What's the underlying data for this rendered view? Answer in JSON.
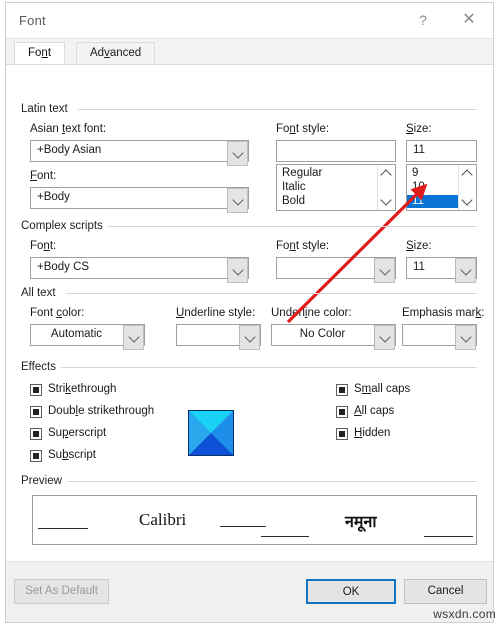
{
  "window": {
    "title": "Font",
    "help_icon": "question-mark-icon",
    "close_icon": "close-icon"
  },
  "tabs": [
    {
      "label": "Font",
      "accel": "n",
      "active": true
    },
    {
      "label": "Advanced",
      "accel": "v",
      "active": false
    }
  ],
  "groups": {
    "latin_text": "Latin text",
    "complex_scripts": "Complex scripts",
    "all_text": "All text",
    "effects": "Effects",
    "preview": "Preview"
  },
  "latin": {
    "asian_font_label": "Asian text font:",
    "asian_font_accel": "t",
    "asian_font_value": "+Body Asian",
    "font_label": "Font:",
    "font_accel": "F",
    "font_value": "+Body",
    "font_style_label": "Font style:",
    "font_style_accel": "n",
    "font_style_value": "",
    "font_style_options": [
      "Regular",
      "Italic",
      "Bold"
    ],
    "size_label": "Size:",
    "size_accel": "S",
    "size_value": "11",
    "size_options": [
      "9",
      "10",
      "11"
    ],
    "size_selected": "11"
  },
  "complex": {
    "font_label": "Font:",
    "font_accel": "n",
    "font_value": "+Body CS",
    "font_style_label": "Font style:",
    "font_style_accel": "n",
    "font_style_value": "",
    "size_label": "Size:",
    "size_accel": "S",
    "size_value": "11"
  },
  "all_text": {
    "font_color_label": "Font color:",
    "font_color_accel": "c",
    "font_color_value": "Automatic",
    "underline_style_label": "Underline style:",
    "underline_style_accel": "U",
    "underline_style_value": "",
    "underline_color_label": "Underline color:",
    "underline_color_accel": "i",
    "underline_color_value": "No Color",
    "emphasis_mark_label": "Emphasis mark:",
    "emphasis_mark_accel": "k",
    "emphasis_mark_value": ""
  },
  "effects": {
    "left": [
      {
        "label": "Strikethrough",
        "accel": "k",
        "state": "indeterminate"
      },
      {
        "label": "Double strikethrough",
        "accel": "l",
        "state": "indeterminate"
      },
      {
        "label": "Superscript",
        "accel": "p",
        "state": "indeterminate"
      },
      {
        "label": "Subscript",
        "accel": "b",
        "state": "indeterminate"
      }
    ],
    "right": [
      {
        "label": "Small caps",
        "accel": "m",
        "state": "indeterminate"
      },
      {
        "label": "All caps",
        "accel": "A",
        "state": "indeterminate"
      },
      {
        "label": "Hidden",
        "accel": "H",
        "state": "indeterminate"
      }
    ],
    "image_placeholder": "broken-image-icon"
  },
  "preview": {
    "latin_sample": "Calibri",
    "complex_sample": "नमूना"
  },
  "footer": {
    "set_as_default": "Set As Default",
    "set_as_default_enabled": false,
    "ok": "OK",
    "cancel": "Cancel"
  },
  "annotation": {
    "arrow_color": "#e01b1b",
    "points_at": "size-list-item-11"
  },
  "watermark": "wsxdn.com"
}
